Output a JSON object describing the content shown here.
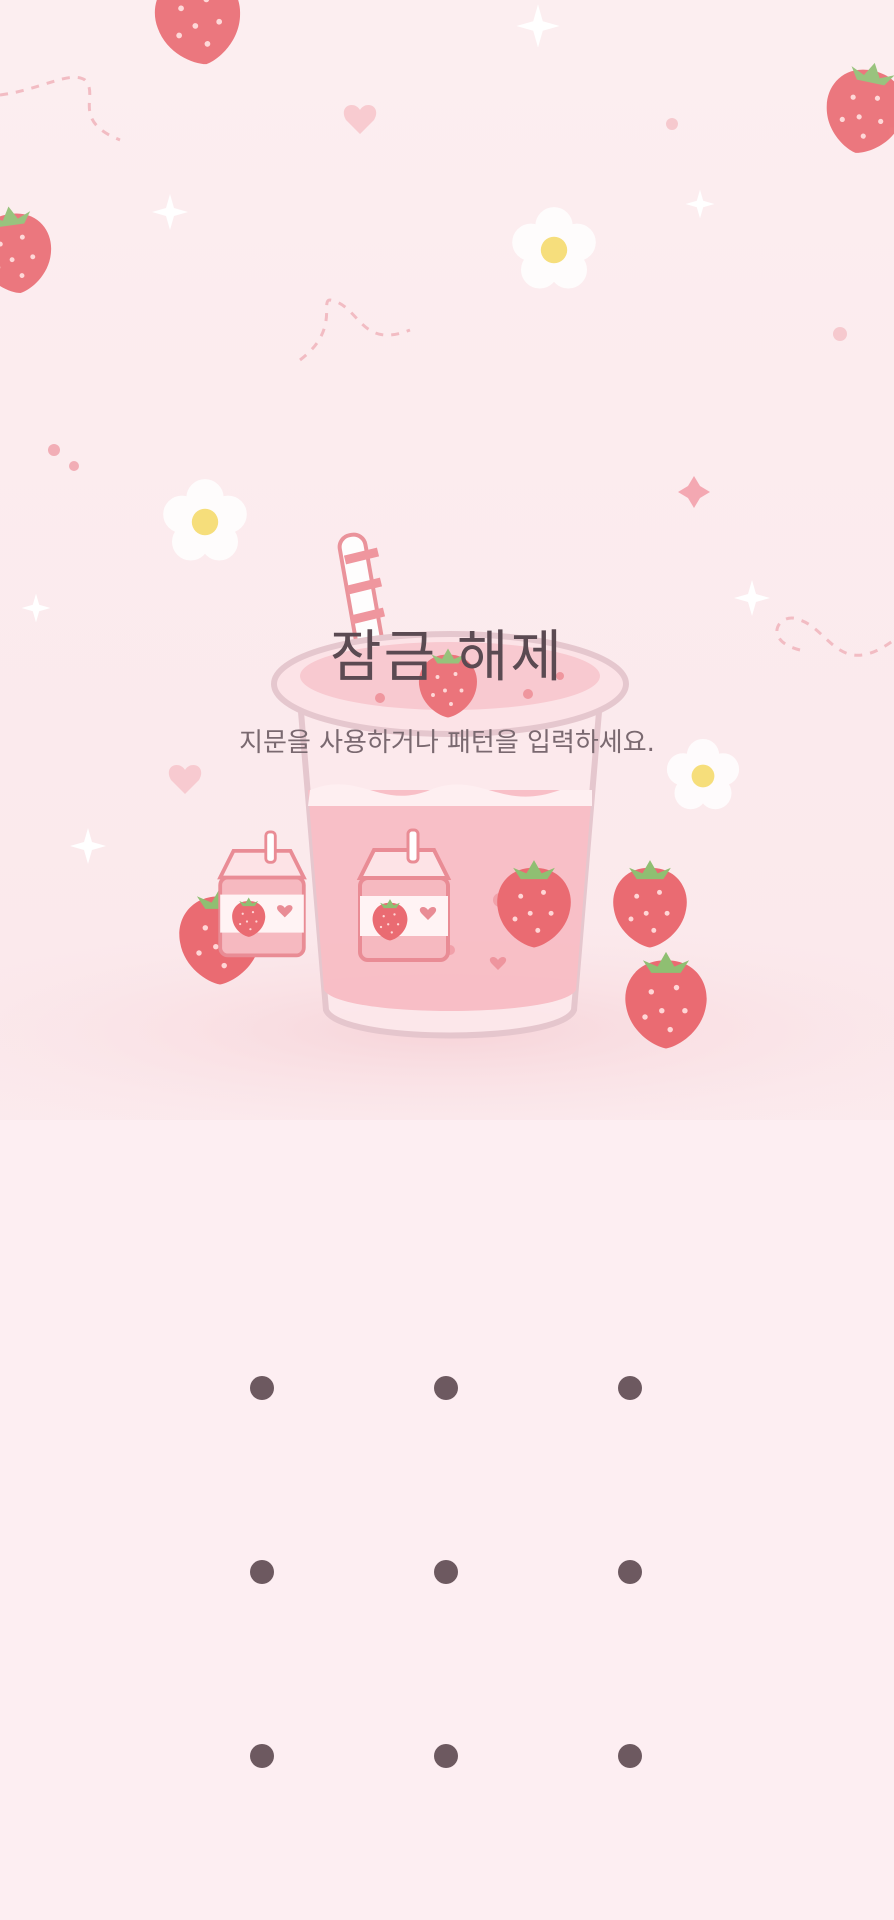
{
  "lock_screen": {
    "title": "잠금 해제",
    "subtitle": "지문을 사용하거나 패턴을 입력하세요."
  },
  "pattern_grid": {
    "rows": 3,
    "cols": 3,
    "dot_color": "#6d5960"
  },
  "wallpaper": {
    "theme": "strawberry-milk",
    "accent": "#e8606a",
    "background": "#fdeef2"
  }
}
